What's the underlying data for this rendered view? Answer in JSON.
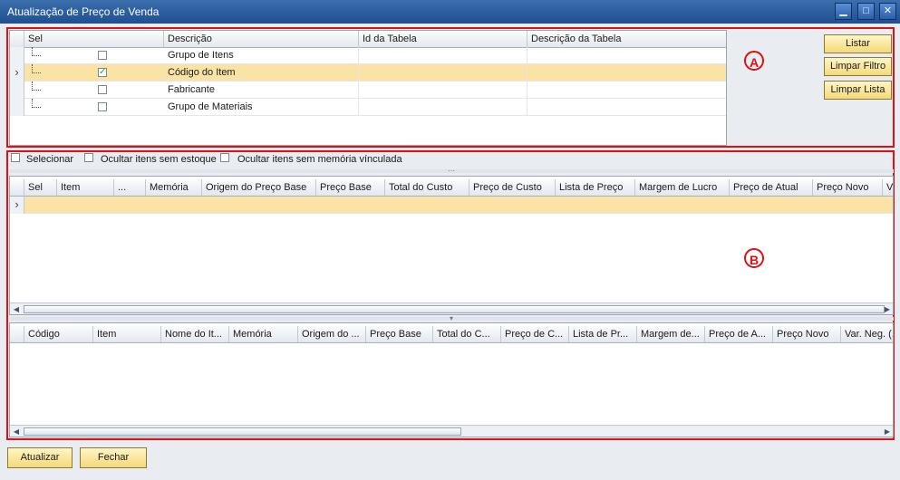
{
  "window": {
    "title": "Atualização de Preço de Venda",
    "minimize_glyph": "▁",
    "maximize_glyph": "□",
    "close_glyph": "✕"
  },
  "icons": {
    "row_pointer": "chevron-right-icon",
    "scroll_left": "triangle-left-icon",
    "scroll_right": "triangle-right-icon",
    "splitter_grip": "grip-dots-icon"
  },
  "glyphs": {
    "pointer": "›",
    "left": "◀",
    "right": "▶",
    "grip": "⋯",
    "grip_down": "▾"
  },
  "filter_grid": {
    "columns": [
      "Sel",
      "Descrição",
      "Id da Tabela",
      "Descrição da Tabela"
    ],
    "rows": [
      {
        "descricao": "Grupo de Itens",
        "checked": false
      },
      {
        "descricao": "Código do Item",
        "checked": true
      },
      {
        "descricao": "Fabricante",
        "checked": false
      },
      {
        "descricao": "Grupo de Materiais",
        "checked": false
      }
    ]
  },
  "side_buttons": {
    "listar": "Listar",
    "limpar_filtro": "Limpar Filtro",
    "limpar_lista": "Limpar Lista"
  },
  "annotations": {
    "a": "A",
    "b": "B"
  },
  "options": {
    "selecionar": "Selecionar",
    "ocultar_estoque": "Ocultar itens sem estoque",
    "ocultar_memoria": "Ocultar itens sem memória vínculada"
  },
  "items_grid": {
    "columns": [
      "Sel",
      "Item",
      "...",
      "Memória",
      "Origem do Preço Base",
      "Preço Base",
      "Total do Custo",
      "Preço de Custo",
      "Lista de Preço",
      "Margem de Lucro",
      "Preço de Atual",
      "Preço Novo",
      "Va"
    ]
  },
  "detail_grid": {
    "columns": [
      "Código",
      "Item",
      "Nome do It...",
      "Memória",
      "Origem do ...",
      "Preço Base",
      "Total do C...",
      "Preço de C...",
      "Lista de Pr...",
      "Margem de...",
      "Preço de A...",
      "Preço Novo",
      "Var. Neg. (..."
    ]
  },
  "footer": {
    "atualizar": "Atualizar",
    "fechar": "Fechar"
  }
}
